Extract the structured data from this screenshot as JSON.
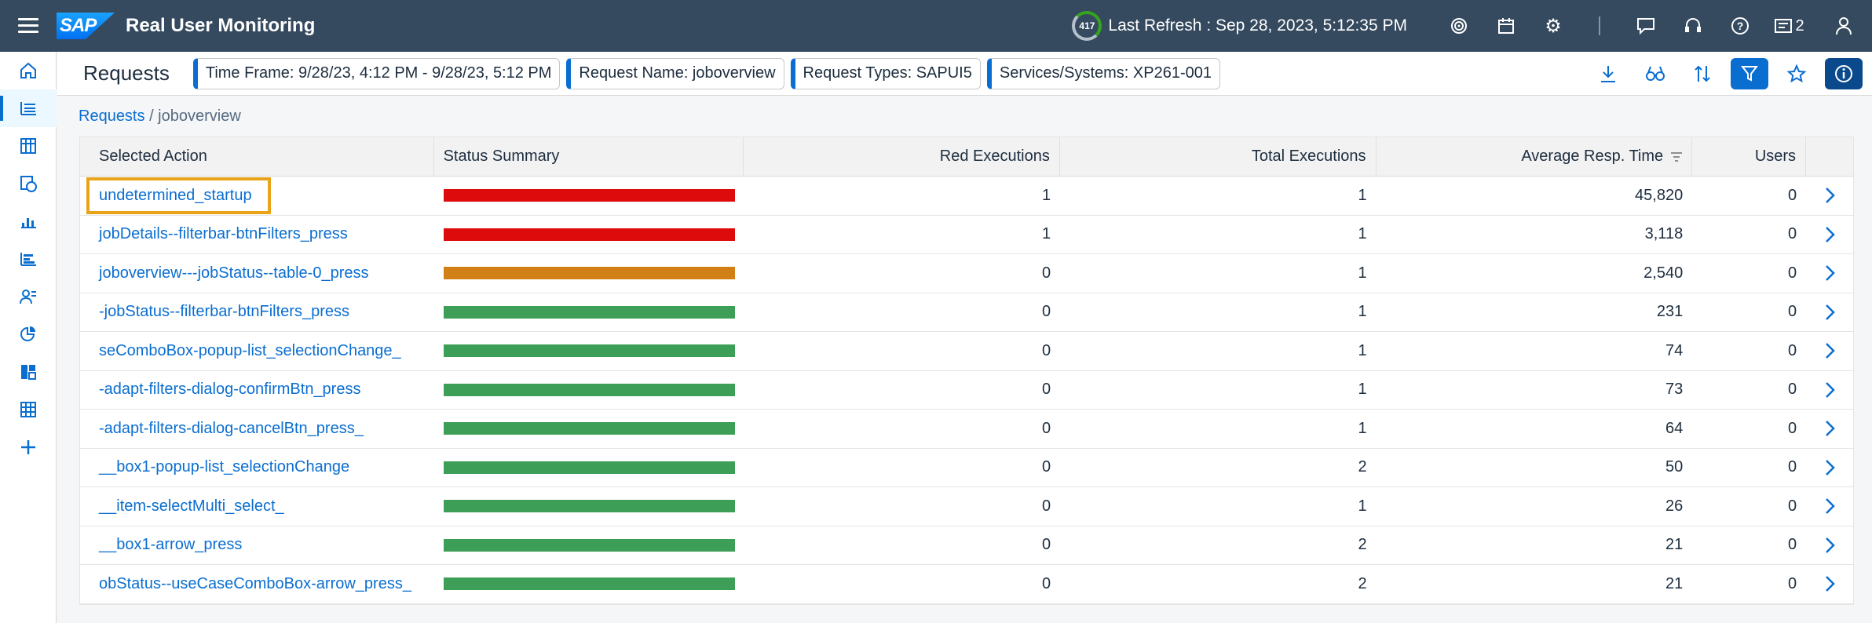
{
  "shell": {
    "title": "Real User Monitoring",
    "logo_text": "SAP",
    "refresh_badge": "417",
    "last_refresh": "Last Refresh : Sep 28, 2023, 5:12:35 PM",
    "notification_count": "2"
  },
  "page": {
    "title": "Requests",
    "tokens": [
      "Time Frame: 9/28/23, 4:12 PM - 9/28/23, 5:12 PM",
      "Request Name: joboverview",
      "Request Types: SAPUI5",
      "Services/Systems: XP261-001"
    ]
  },
  "breadcrumb": {
    "link": "Requests",
    "current": "/ joboverview"
  },
  "table": {
    "columns": [
      "Selected Action",
      "Status Summary",
      "Red Executions",
      "Total Executions",
      "Average Resp. Time",
      "Users"
    ],
    "rows": [
      {
        "action": "undetermined_startup",
        "status": "red",
        "red": "1",
        "total": "1",
        "avg": "45,820",
        "users": "0"
      },
      {
        "action": "jobDetails--filterbar-btnFilters_press",
        "status": "red",
        "red": "1",
        "total": "1",
        "avg": "3,118",
        "users": "0"
      },
      {
        "action": "joboverview---jobStatus--table-0_press",
        "status": "orange",
        "red": "0",
        "total": "1",
        "avg": "2,540",
        "users": "0"
      },
      {
        "action": "-jobStatus--filterbar-btnFilters_press",
        "status": "green",
        "red": "0",
        "total": "1",
        "avg": "231",
        "users": "0"
      },
      {
        "action": "seComboBox-popup-list_selectionChange_",
        "status": "green",
        "red": "0",
        "total": "1",
        "avg": "74",
        "users": "0"
      },
      {
        "action": "-adapt-filters-dialog-confirmBtn_press",
        "status": "green",
        "red": "0",
        "total": "1",
        "avg": "73",
        "users": "0"
      },
      {
        "action": "-adapt-filters-dialog-cancelBtn_press_",
        "status": "green",
        "red": "0",
        "total": "1",
        "avg": "64",
        "users": "0"
      },
      {
        "action": "__box1-popup-list_selectionChange",
        "status": "green",
        "red": "0",
        "total": "2",
        "avg": "50",
        "users": "0"
      },
      {
        "action": "__item-selectMulti_select_",
        "status": "green",
        "red": "0",
        "total": "1",
        "avg": "26",
        "users": "0"
      },
      {
        "action": "__box1-arrow_press",
        "status": "green",
        "red": "0",
        "total": "2",
        "avg": "21",
        "users": "0"
      },
      {
        "action": "obStatus--useCaseComboBox-arrow_press_",
        "status": "green",
        "red": "0",
        "total": "2",
        "avg": "21",
        "users": "0"
      }
    ]
  },
  "colors": {
    "shell_bg": "#354a5f",
    "accent": "#0a6ed1",
    "status_red": "#dd0b0b",
    "status_orange": "#d08014",
    "status_green": "#3d9e57",
    "focus_outline": "#e9a319"
  },
  "icons": {
    "shell": [
      "menu-icon",
      "target-icon",
      "calendar-icon",
      "settings-icon",
      "feedback-icon",
      "headset-icon",
      "help-icon",
      "notifications-icon",
      "user-icon"
    ],
    "toolbar": [
      "download-icon",
      "binoculars-icon",
      "sort-icon",
      "filter-icon",
      "favorite-icon",
      "info-icon"
    ],
    "sidenav": [
      "home-icon",
      "requests-icon",
      "table-icon",
      "globe-icon",
      "scatter-icon",
      "bar-chart-icon",
      "users-icon",
      "pie-chart-icon",
      "dashboard-icon",
      "grid-icon",
      "add-icon"
    ]
  }
}
